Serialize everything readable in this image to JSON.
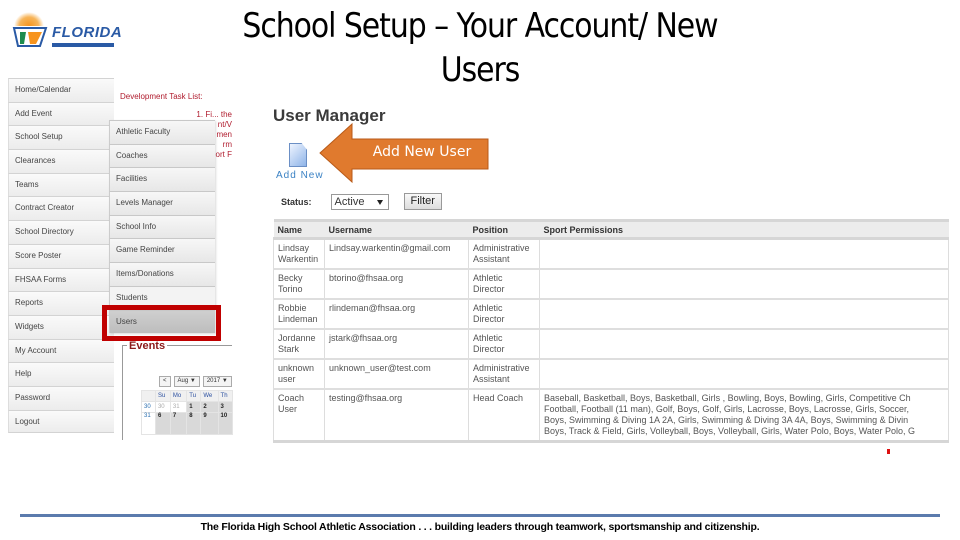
{
  "logo": {
    "word": "FLORIDA",
    "alt": "Florida High School Athletic Association logo"
  },
  "slide": {
    "title": "School Setup – Your Account/ New Users"
  },
  "main_menu": {
    "items": [
      {
        "label": "Home/Calendar",
        "has_sub": false
      },
      {
        "label": "Add Event",
        "has_sub": false
      },
      {
        "label": "School Setup",
        "has_sub": true
      },
      {
        "label": "Clearances",
        "has_sub": true
      },
      {
        "label": "Teams",
        "has_sub": false
      },
      {
        "label": "Contract Creator",
        "has_sub": false
      },
      {
        "label": "School Directory",
        "has_sub": false
      },
      {
        "label": "Score Poster",
        "has_sub": false
      },
      {
        "label": "FHSAA Forms",
        "has_sub": true
      },
      {
        "label": "Reports",
        "has_sub": false
      },
      {
        "label": "Widgets",
        "has_sub": false
      },
      {
        "label": "My Account",
        "has_sub": false
      },
      {
        "label": "Help",
        "has_sub": false
      },
      {
        "label": "Password",
        "has_sub": false
      },
      {
        "label": "Logout",
        "has_sub": false
      }
    ]
  },
  "sub_menu": {
    "items": [
      {
        "label": "Athletic Faculty"
      },
      {
        "label": "Coaches"
      },
      {
        "label": "Facilities"
      },
      {
        "label": "Levels Manager"
      },
      {
        "label": "School Info"
      },
      {
        "label": "Game Reminder"
      },
      {
        "label": "Items/Donations"
      },
      {
        "label": "Students"
      },
      {
        "label": "Users",
        "highlighted": true
      }
    ]
  },
  "dev_task_list": {
    "title": "Development Task List:",
    "lines": [
      "1. Fi... the",
      "nt/V",
      "men",
      "rm",
      "ort F"
    ]
  },
  "events": {
    "label": "Events",
    "calendar": {
      "prev_button": "<",
      "month": "Aug",
      "year": "2017",
      "weekdays": [
        "Su",
        "Mo",
        "Tu",
        "We",
        "Th"
      ],
      "weeks": [
        {
          "week": "30",
          "days": [
            "30",
            "31",
            "1",
            "2",
            "3"
          ],
          "prev_count": 2
        },
        {
          "week": "31",
          "days": [
            "6",
            "7",
            "8",
            "9",
            "10"
          ],
          "prev_count": 0
        }
      ]
    }
  },
  "user_manager": {
    "title": "User Manager",
    "add_new_label": "Add New",
    "callout_text": "Add New User",
    "status_label": "Status:",
    "status_value": "Active",
    "filter_button": "Filter",
    "columns": [
      "Name",
      "Username",
      "Position",
      "Sport Permissions"
    ],
    "rows": [
      {
        "name": "Lindsay Warkentin",
        "username": "Lindsay.warkentin@gmail.com",
        "position": "Administrative Assistant",
        "permissions": []
      },
      {
        "name": "Becky Torino",
        "username": "btorino@fhsaa.org",
        "position": "Athletic Director",
        "permissions": []
      },
      {
        "name": "Robbie Lindeman",
        "username": "rlindeman@fhsaa.org",
        "position": "Athletic Director",
        "permissions": []
      },
      {
        "name": "Jordanne Stark",
        "username": "jstark@fhsaa.org",
        "position": "Athletic Director",
        "permissions": []
      },
      {
        "name": "unknown user",
        "username": "unknown_user@test.com",
        "position": "Administrative Assistant",
        "permissions": []
      },
      {
        "name": "Coach User",
        "username": "testing@fhsaa.org",
        "position": "Head Coach",
        "permissions": [
          "Baseball, Basketball, Boys, Basketball, Girls , Bowling, Boys, Bowling, Girls, Competitive Ch",
          "Football, Football (11 man), Golf, Boys, Golf, Girls, Lacrosse, Boys, Lacrosse, Girls, Soccer,",
          "Boys, Swimming & Diving 1A 2A, Girls, Swimming & Diving 3A 4A, Boys, Swimming & Divin",
          "Boys, Track & Field, Girls, Volleyball, Boys, Volleyball, Girls, Water Polo, Boys, Water Polo, G"
        ]
      }
    ]
  },
  "footer": {
    "text": "The Florida High School Athletic Association . . . building leaders through teamwork, sportsmanship and citizenship."
  },
  "colors": {
    "highlight": "#c00000",
    "callout": "#e07a2e",
    "footer_rule": "#5b7bad",
    "link": "#3b82c4",
    "dev_text": "#b01c2e"
  }
}
